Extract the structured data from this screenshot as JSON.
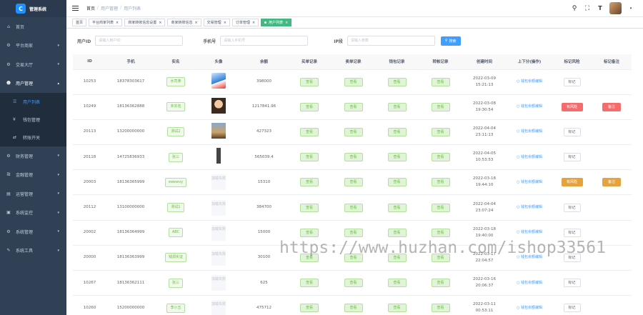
{
  "sidebar": {
    "logo_text": "管理系统",
    "items": [
      {
        "label": "首页",
        "icon": "dashboard-icon"
      },
      {
        "label": "平台商家",
        "icon": "gear-icon",
        "chevron": true
      },
      {
        "label": "交易大厅",
        "icon": "gear-icon",
        "chevron": true
      },
      {
        "label": "用户管理",
        "icon": "user-icon",
        "chevron": true,
        "open": true
      },
      {
        "label": "财务管理",
        "icon": "gear-icon",
        "chevron": true
      },
      {
        "label": "金融管理",
        "icon": "bank-icon",
        "chevron": true
      },
      {
        "label": "运营管理",
        "icon": "operation-icon",
        "chevron": true
      },
      {
        "label": "系统监控",
        "icon": "monitor-icon",
        "chevron": true
      },
      {
        "label": "系统管理",
        "icon": "gear-icon",
        "chevron": true
      },
      {
        "label": "系统工具",
        "icon": "tool-icon",
        "chevron": true
      }
    ],
    "submenu": [
      {
        "label": "用户列表",
        "active": true
      },
      {
        "label": "钱包管理"
      },
      {
        "label": "转账开关"
      }
    ]
  },
  "header": {
    "breadcrumb": [
      "首页",
      "用户管理",
      "用户列表"
    ]
  },
  "tags": [
    "首页",
    "平台商家列表",
    "商家转账信息设置",
    "商家转账信息",
    "交易管理",
    "订单管理",
    "用户列表"
  ],
  "search": {
    "fields": [
      {
        "label": "用户ID",
        "placeholder": "请输入用户ID"
      },
      {
        "label": "手机号",
        "placeholder": "请输入手机号"
      },
      {
        "label": "IP段",
        "placeholder": "请输入参数"
      }
    ],
    "button": "搜索"
  },
  "table": {
    "headers": [
      "ID",
      "手机",
      "实名",
      "头像",
      "余额",
      "买单记录",
      "卖单记录",
      "钱包记录",
      "转帐记录",
      "创建时间",
      "上下分(操作)",
      "标记风险",
      "标记备注"
    ],
    "view_label": "查看",
    "op_label": "钱包余额编辑",
    "mark_label": "标记",
    "avatar_placeholder": "加载失败",
    "rows": [
      {
        "id": "10253",
        "phone": "18378303617",
        "name": "水司楽",
        "avatar": "img1",
        "balance": "398000",
        "time": "2022-03-09 15:21:13",
        "risk": "标记",
        "risk_style": "plain",
        "remark": ""
      },
      {
        "id": "10249",
        "phone": "18136362888",
        "name": "未实名",
        "avatar": "img2",
        "balance": "1217841.96",
        "time": "2022-03-08 19:30:54",
        "risk": "有风险",
        "risk_style": "red",
        "remark": "备注",
        "remark_style": "red"
      },
      {
        "id": "20113",
        "phone": "13200000000",
        "name": "测试2",
        "avatar": "img3",
        "balance": "427323",
        "time": "2022-04-04 23:11:13",
        "risk": "标记",
        "risk_style": "plain",
        "remark": ""
      },
      {
        "id": "20118",
        "phone": "14725836933",
        "name": "张三",
        "avatar": "img4",
        "balance": "565039.4",
        "time": "2022-04-05 10:53:53",
        "risk": "标记",
        "risk_style": "plain",
        "remark": ""
      },
      {
        "id": "20003",
        "phone": "18136365999",
        "name": "ewewvy",
        "avatar": "",
        "balance": "15310",
        "time": "2022-03-18 19:44:10",
        "risk": "有风险",
        "risk_style": "orange",
        "remark": "备注",
        "remark_style": "orange"
      },
      {
        "id": "20112",
        "phone": "13100000000",
        "name": "测试1",
        "avatar": "",
        "balance": "384700",
        "time": "2022-04-04 23:07:24",
        "risk": "标记",
        "risk_style": "plain",
        "remark": ""
      },
      {
        "id": "20002",
        "phone": "18136364999",
        "name": "ABC",
        "avatar": "",
        "balance": "15000",
        "time": "2022-03-18 19:40:00",
        "risk": "标记",
        "risk_style": "plain",
        "remark": ""
      },
      {
        "id": "20000",
        "phone": "18136363999",
        "name": "钱源实证",
        "avatar": "",
        "balance": "30100",
        "time": "2022-03-17 22:04:57",
        "risk": "标记",
        "risk_style": "plain",
        "remark": ""
      },
      {
        "id": "10267",
        "phone": "18136362111",
        "name": "张三",
        "avatar": "",
        "balance": "625",
        "time": "2022-03-16 20:06:37",
        "risk": "标记",
        "risk_style": "plain",
        "remark": ""
      },
      {
        "id": "10260",
        "phone": "15200000000",
        "name": "李小五",
        "avatar": "",
        "balance": "475712",
        "time": "2022-03-11 00:53:11",
        "risk": "标记",
        "risk_style": "plain",
        "remark": ""
      }
    ]
  },
  "watermark": "https://www.huzhan.com/ishop33561"
}
